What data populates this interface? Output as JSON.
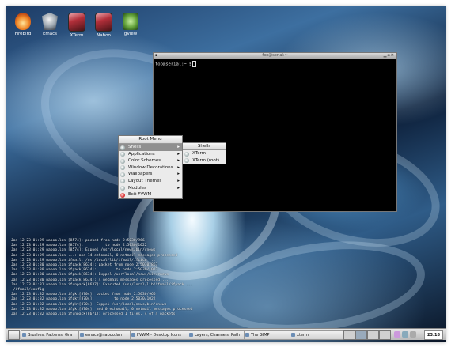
{
  "desktop_icons": [
    {
      "label": "Firebird",
      "icon": "firebird-icon"
    },
    {
      "label": "Emacs",
      "icon": "emacs-icon"
    },
    {
      "label": "XTerm",
      "icon": "xterm-icon"
    },
    {
      "label": "Naboo",
      "icon": "naboo-icon"
    },
    {
      "label": "gView",
      "icon": "gview-icon"
    }
  ],
  "terminal": {
    "title": "foo@serial:~",
    "prompt": "foo@serial:~]$"
  },
  "root_menu": {
    "title": "Root Menu",
    "items": [
      "Shells",
      "Applications",
      "Color Schemes",
      "Window Decorations",
      "Wallpapers",
      "Layout Themes",
      "Modules",
      "Exit FVWM"
    ]
  },
  "shells_menu": {
    "title": "Shells",
    "items": [
      "XTerm",
      "XTerm (root)"
    ]
  },
  "log_lines": [
    "Jan 12 23:01:29 naboo.lan [8574]: packet from node 2:5030/966",
    "Jan 12 23:01:29 naboo.lan [8574]:          to node 2:5030/1022",
    "Jan 12 23:01:29 naboo.lan [8574]: Exppel /usr/local/news/bin/rnews",
    "Jan 12 23:01:29 naboo.lan ...: and 14 echomail, 0 netmail messages processed",
    "Jan 12 23:01:29 naboo.lan ifmail: /usr/local/lib/ifmail/ifcico ...",
    "Jan 12 23:01:30 naboo.lan ifpack[8634]: packet from node 2:5030/863",
    "Jan 12 23:01:30 naboo.lan ifpack[8634]:         to node 2:5030/1022",
    "Jan 12 23:01:30 naboo.lan ifpack[8634]: Exppel /usr/local/news/bin/rnews",
    "Jan 12 23:01:30 naboo.lan ifpack[8634]: 4 netmail messages processed ...",
    "Jan 12 23:01:31 naboo.lan ifunpack[8637]: Executed /usr/local/lib/ifmail/ifpack ...",
    "~/ifmail/config",
    "Jan 12 23:01:32 naboo.lan ifpkt[8704]: packet from node 2:5030/966",
    "Jan 12 23:01:32 naboo.lan ifpkt[8704]:         to node 2:5030/1022",
    "Jan 12 23:01:32 naboo.lan ifpkt[8704]: Exppel /usr/local/news/bin/rnews",
    "Jan 12 23:01:32 naboo.lan ifpkt[8704]: and 0 echomail, 0 netmail messages processed",
    "Jan 12 23:01:32 naboo.lan ifunpack[8671]: processed 1 files, 4 of 4 packets"
  ],
  "taskbar": {
    "tasks": [
      "Brushes, Patterns, Gra",
      "emacs@naboo.lan",
      "FVWM - Desktop Icons",
      "Layers, Channels, Path",
      "The GIMP",
      "xterm"
    ],
    "clock": "23:18"
  }
}
